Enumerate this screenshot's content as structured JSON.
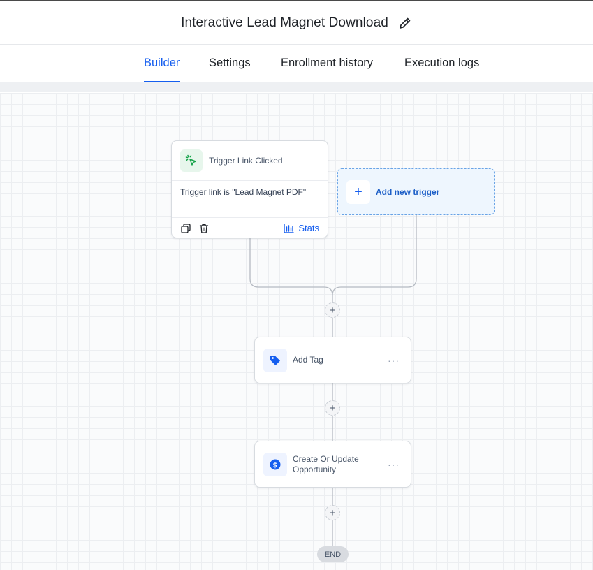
{
  "header": {
    "title": "Interactive Lead Magnet Download",
    "edit_icon": "pencil-icon"
  },
  "tabs": [
    {
      "label": "Builder",
      "active": true
    },
    {
      "label": "Settings",
      "active": false
    },
    {
      "label": "Enrollment history",
      "active": false
    },
    {
      "label": "Execution logs",
      "active": false
    }
  ],
  "trigger": {
    "title": "Trigger Link Clicked",
    "condition": "Trigger link is \"Lead Magnet PDF\"",
    "stats_label": "Stats",
    "icon": "cursor-click-icon"
  },
  "add_trigger": {
    "label": "Add new trigger",
    "icon": "plus-icon"
  },
  "actions": [
    {
      "label": "Add Tag",
      "icon": "tag-icon"
    },
    {
      "label": "Create Or Update Opportunity",
      "icon": "dollar-icon"
    }
  ],
  "plus_symbol": "+",
  "more_symbol": "···",
  "end_label": "END",
  "colors": {
    "accent": "#155eef",
    "trigger_icon_bg": "#e7f6ec",
    "trigger_icon": "#16a34a",
    "add_trigger_bg": "#eef6fe"
  }
}
